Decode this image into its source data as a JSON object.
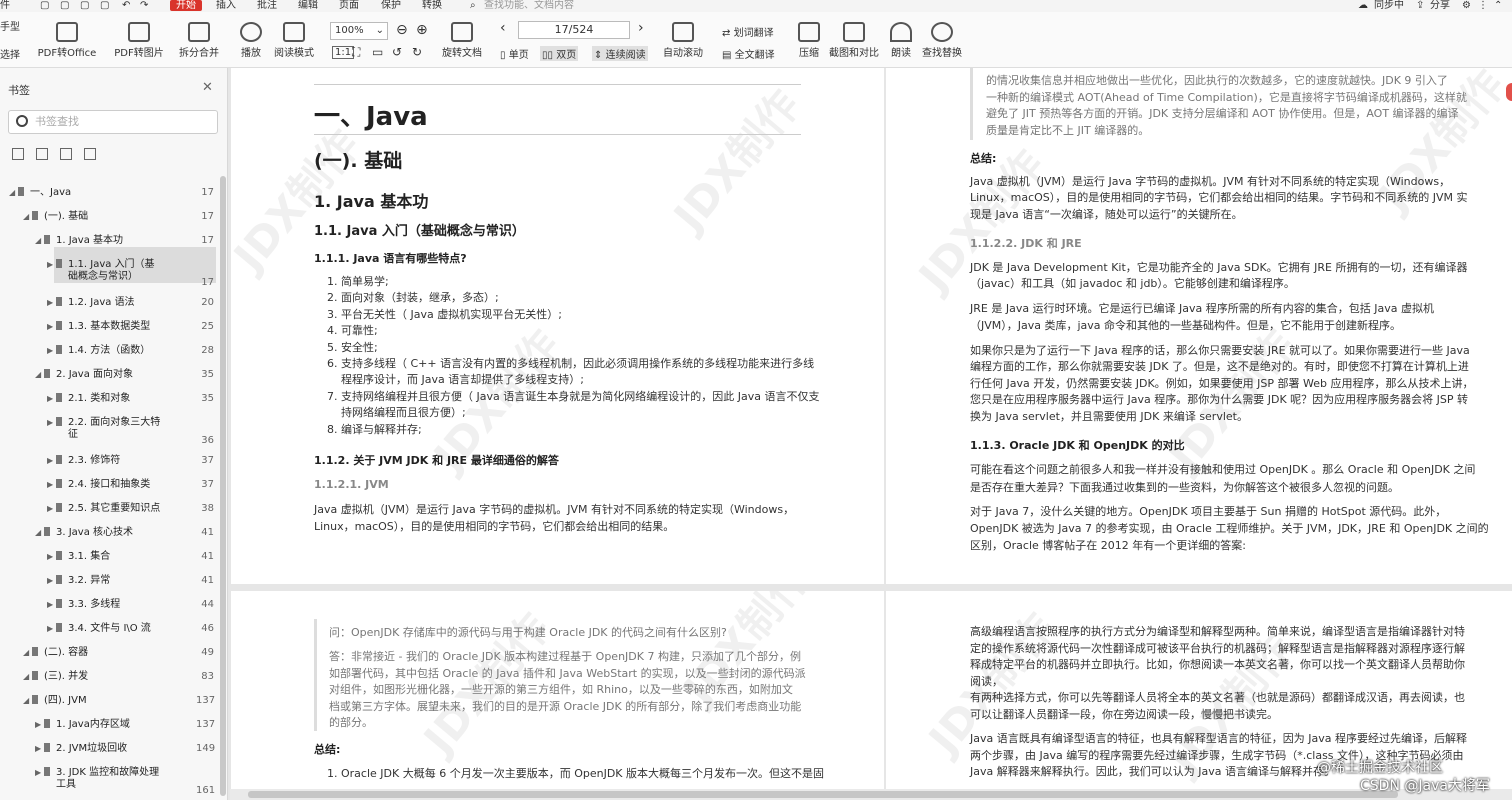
{
  "topbar": {
    "items": [
      "件",
      "开始",
      "插入",
      "批注",
      "编辑",
      "页面",
      "保护",
      "转换"
    ],
    "search": "查找功能、文档内容",
    "sync": "同步中",
    "share": "分享"
  },
  "toolbar": {
    "left_cut": "手型",
    "left_cut2": "选择",
    "pdf_office": "PDF转Office",
    "pdf_image": "PDF转图片",
    "split_merge": "拆分合并",
    "play": "播放",
    "read_mode": "阅读模式",
    "zoom": "100%",
    "page_indicator": "17/524",
    "rotate": "旋转文档",
    "single": "单页",
    "double": "双页",
    "continuous": "连续阅读",
    "auto_scroll": "自动滚动",
    "translate": "划词翻译",
    "full_translate": "全文翻译",
    "compress": "压缩",
    "screenshot": "截图和对比",
    "read_aloud": "朗读",
    "find_replace": "查找替换"
  },
  "sidebar": {
    "title": "书签",
    "search_placeholder": "书签查找",
    "items": [
      {
        "label": "一、Java",
        "page": "17"
      },
      {
        "label": "(一). 基础",
        "page": "17"
      },
      {
        "label": "1. Java 基本功",
        "page": "17"
      },
      {
        "label": "1.1. Java 入门（基",
        "label2": "础概念与常识）",
        "page": "17"
      },
      {
        "label": "1.2. Java 语法",
        "page": "20"
      },
      {
        "label": "1.3. 基本数据类型",
        "page": "25"
      },
      {
        "label": "1.4. 方法（函数）",
        "page": "28"
      },
      {
        "label": "2. Java 面向对象",
        "page": "35"
      },
      {
        "label": "2.1. 类和对象",
        "page": "35"
      },
      {
        "label": "2.2. 面向对象三大特",
        "label2": "征",
        "page": "36"
      },
      {
        "label": "2.3. 修饰符",
        "page": "37"
      },
      {
        "label": "2.4. 接口和抽象类",
        "page": "37"
      },
      {
        "label": "2.5. 其它重要知识点",
        "page": "38"
      },
      {
        "label": "3. Java 核心技术",
        "page": "41"
      },
      {
        "label": "3.1. 集合",
        "page": "41"
      },
      {
        "label": "3.2. 异常",
        "page": "41"
      },
      {
        "label": "3.3. 多线程",
        "page": "44"
      },
      {
        "label": "3.4. 文件与 I\\O 流",
        "page": "46"
      },
      {
        "label": "(二). 容器",
        "page": "49"
      },
      {
        "label": "(三). 并发",
        "page": "83"
      },
      {
        "label": "(四). JVM",
        "page": "137"
      },
      {
        "label": "1. Java内存区域",
        "page": "137"
      },
      {
        "label": "2. JVM垃圾回收",
        "page": "149"
      },
      {
        "label": "3. JDK 监控和故障处理",
        "label2": "工具",
        "page": "161"
      }
    ]
  },
  "page1": {
    "h1": "一、Java",
    "h2": "(一). 基础",
    "h3": "1. Java 基本功",
    "h4": "1.1. Java 入门（基础概念与常识）",
    "h5a": "1.1.1. Java 语言有哪些特点?",
    "list": [
      "1. 简单易学;",
      "2. 面向对象（封装，继承，多态）;",
      "3. 平台无关性（ Java 虚拟机实现平台无关性）;",
      "4. 可靠性;",
      "5. 安全性;",
      "6. 支持多线程（ C++ 语言没有内置的多线程机制，因此必须调用操作系统的多线程功能来进行多线",
      "程程序设计，而 Java 语言却提供了多线程支持）;",
      "7. 支持网络编程并且很方便（ Java 语言诞生本身就是为简化网络编程设计的，因此 Java 语言不仅支",
      "持网络编程而且很方便）;",
      "8. 编译与解释并存;"
    ],
    "h5b": "1.1.2. 关于 JVM JDK 和 JRE 最详细通俗的解答",
    "h6": "1.1.2.1. JVM",
    "para": [
      "Java 虚拟机（JVM）是运行 Java 字节码的虚拟机。JVM 有针对不同系统的特定实现（Windows，",
      "Linux，macOS），目的是使用相同的字节码，它们都会给出相同的结果。"
    ]
  },
  "page2": {
    "quote": [
      "的情况收集信息并相应地做出一些优化，因此执行的次数越多，它的速度就越快。JDK 9 引入了",
      "一种新的编译模式 AOT(Ahead of Time Compilation)，它是直接将字节码编译成机器码，这样就",
      "避免了 JIT 预热等各方面的开销。JDK 支持分层编译和 AOT 协作使用。但是，AOT 编译器的编译",
      "质量是肯定比不上 JIT 编译器的。"
    ],
    "summary": "总结:",
    "p1": [
      "Java 虚拟机（JVM）是运行 Java 字节码的虚拟机。JVM 有针对不同系统的特定实现（Windows，",
      "Linux，macOS），目的是使用相同的字节码，它们都会给出相同的结果。字节码和不同系统的 JVM 实",
      "现是 Java 语言“一次编译，随处可以运行”的关键所在。"
    ],
    "h6": "1.1.2.2. JDK 和 JRE",
    "p2": [
      "JDK 是 Java Development Kit，它是功能齐全的 Java SDK。它拥有 JRE 所拥有的一切，还有编译器",
      "（javac）和工具（如 javadoc 和 jdb）。它能够创建和编译程序。"
    ],
    "p3": [
      "JRE 是 Java 运行时环境。它是运行已编译 Java 程序所需的所有内容的集合，包括 Java 虚拟机",
      "（JVM），Java 类库，java 命令和其他的一些基础构件。但是，它不能用于创建新程序。"
    ],
    "p4": [
      "如果你只是为了运行一下 Java 程序的话，那么你只需要安装 JRE 就可以了。如果你需要进行一些 Java",
      "编程方面的工作，那么你就需要安装 JDK 了。但是，这不是绝对的。有时，即使您不打算在计算机上进",
      "行任何 Java 开发，仍然需要安装 JDK。例如，如果要使用 JSP 部署 Web 应用程序，那么从技术上讲，",
      "您只是在应用程序服务器中运行 Java 程序。那你为什么需要 JDK 呢？因为应用程序服务器会将 JSP 转",
      "换为 Java servlet，并且需要使用 JDK 来编译 servlet。"
    ],
    "h5": "1.1.3. Oracle JDK 和 OpenJDK 的对比",
    "p5": [
      "可能在看这个问题之前很多人和我一样并没有接触和使用过 OpenJDK 。那么 Oracle 和 OpenJDK 之间",
      "是否存在重大差异？下面我通过收集到的一些资料，为你解答这个被很多人忽视的问题。"
    ],
    "p6": [
      "对于 Java 7，没什么关键的地方。OpenJDK 项目主要基于 Sun 捐赠的 HotSpot 源代码。此外，",
      "OpenJDK 被选为 Java 7 的参考实现，由 Oracle 工程师维护。关于 JVM，JDK，JRE 和 OpenJDK 之间的",
      "区别，Oracle 博客帖子在 2012 年有一个更详细的答案:"
    ]
  },
  "page3": {
    "q1": "问：OpenJDK 存储库中的源代码与用于构建 Oracle JDK 的代码之间有什么区别?",
    "q2": [
      "答：非常接近 - 我们的 Oracle JDK 版本构建过程基于 OpenJDK 7 构建，只添加了几个部分，例",
      "如部署代码，其中包括 Oracle 的 Java 插件和 Java WebStart 的实现，以及一些封闭的源代码派",
      "对组件，如图形光栅化器，一些开源的第三方组件，如 Rhino，以及一些零碎的东西，如附加文",
      "档或第三方字体。展望未来，我们的目的是开源 Oracle JDK 的所有部分，除了我们考虑商业功能",
      "的部分。"
    ],
    "summary": "总结:",
    "li": "1. Oracle JDK 大概每 6 个月发一次主要版本，而 OpenJDK 版本大概每三个月发布一次。但这不是固"
  },
  "page4": {
    "p1": [
      "高级编程语言按照程序的执行方式分为编译型和解释型两种。简单来说，编译型语言是指编译器针对特",
      "定的操作系统将源代码一次性翻译成可被该平台执行的机器码；解释型语言是指解释器对源程序逐行解",
      "释成特定平台的机器码并立即执行。比如，你想阅读一本英文名著，你可以找一个英文翻译人员帮助你",
      "阅读，",
      "有两种选择方式，你可以先等翻译人员将全本的英文名著（也就是源码）都翻译成汉语，再去阅读，也",
      "可以让翻译人员翻译一段，你在旁边阅读一段，慢慢把书读完。"
    ],
    "p2": [
      "Java 语言既具有编译型语言的特征，也具有解释型语言的特征，因为 Java 程序要经过先编译，后解释",
      "两个步骤，由 Java 编写的程序需要先经过编译步骤，生成字节码（*.class 文件），这种字节码必须由",
      "Java 解释器来解释执行。因此，我们可以认为 Java 语言编译与解释并存。"
    ]
  },
  "watermark": "JDX制作",
  "footer": {
    "line1": "@稀土掘金技术社区",
    "line2": "CSDN @Java大将军"
  }
}
